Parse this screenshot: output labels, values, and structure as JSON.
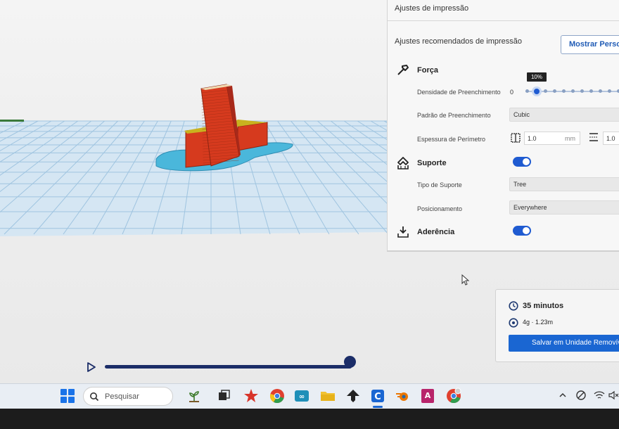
{
  "panel": {
    "header_title": "Ajustes de impressão",
    "recommended_label": "Ajustes recomendados de impressão",
    "custom_button_label": "Mostrar Personalizado"
  },
  "strength": {
    "section_label": "Força",
    "infill_density_label": "Densidade de Preenchimento",
    "infill_density_min": "0",
    "infill_density_value": "10%",
    "infill_density_fraction": 0.1,
    "infill_pattern_label": "Padrão de Preenchimento",
    "infill_pattern_value": "Cubic",
    "wall_thickness_label": "Espessura de Perímetro",
    "wall_thickness_value": "1.0",
    "wall_thickness_unit": "mm",
    "top_bottom_value": "1.0"
  },
  "support": {
    "section_label": "Suporte",
    "enabled": true,
    "type_label": "Tipo de Suporte",
    "type_value": "Tree",
    "placement_label": "Posicionamento",
    "placement_value": "Everywhere"
  },
  "adhesion": {
    "section_label": "Aderência",
    "enabled": true
  },
  "print_info": {
    "time": "35 minutos",
    "material": "4g · 1.23m",
    "save_button_label": "Salvar em Unidade Removível"
  },
  "taskbar": {
    "search_placeholder": "Pesquisar"
  },
  "colors": {
    "accent": "#1f5bd1",
    "model": "#d63a1e",
    "model_top": "#c9b21f",
    "support": "#49b5d8",
    "grid_plate": "#cfe3f2"
  }
}
